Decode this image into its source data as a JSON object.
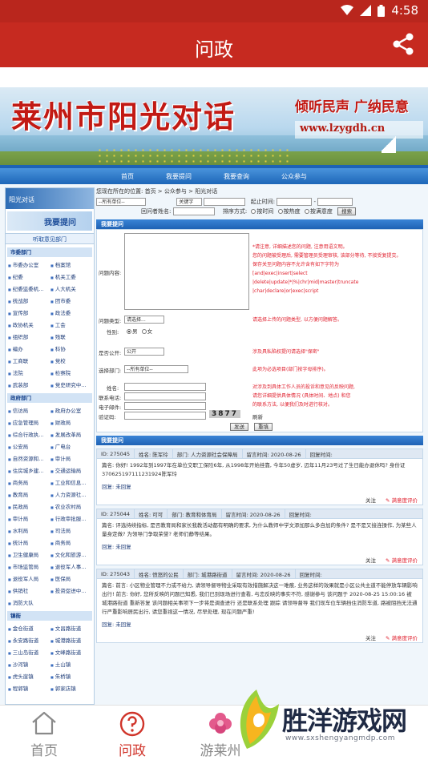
{
  "status": {
    "time": "4:58"
  },
  "appbar": {
    "title": "问政",
    "share_icon": "share-icon"
  },
  "banner": {
    "title": "莱州市阳光对话",
    "slogan": "倾听民声 广纳民意",
    "url": "www.lzygdh.cn"
  },
  "portal_nav": [
    "首页",
    "我要提问",
    "我要查询",
    "公众参与"
  ],
  "left": {
    "img1": "阳光对话",
    "img2": "我要提问",
    "head": "听取意见部门",
    "sec1": "市委部门",
    "depts1": [
      "市委办公室",
      "档案馆",
      "纪委",
      "机关工委",
      "纪委监委机...",
      "人大机关",
      "统战部",
      "团市委",
      "宣传部",
      "政法委",
      "政协机关",
      "工会",
      "组织部",
      "残联",
      "编办",
      "科协",
      "工商联",
      "党校",
      "法院",
      "检察院",
      "武装部",
      "党史研究中..."
    ],
    "sec2": "政府部门",
    "depts2": [
      "信访局",
      "政府办公室",
      "应急管理局",
      "财政局",
      "综合行政执...",
      "发展改革局",
      "公安局",
      "广电台",
      "自然资源和...",
      "审计局",
      "住房城乡建...",
      "交通运输局",
      "商务局",
      "工业和信息...",
      "教育局",
      "人力资源社...",
      "民政局",
      "农业农村局",
      "审计局",
      "行政审批服...",
      "水利局",
      "司法局",
      "统计局",
      "商务局",
      "卫生健康局",
      "文化和旅游...",
      "市场监管局",
      "退役军人事...",
      "退役军人局",
      "医保局",
      "供销社",
      "投资促进中...",
      "消防大队"
    ],
    "sec3": "镇街",
    "depts3": [
      "金仓街道",
      "文昌路街道",
      "永安路街道",
      "城港路街道",
      "三山岛街道",
      "文峰路街道",
      "沙河镇",
      "土山镇",
      "虎头崖镇",
      "朱桥镇",
      "程郭镇",
      "郭家店镇"
    ]
  },
  "main": {
    "crumb": "您现在所在的位置: 首页 > 公众参与 > 阳光对话",
    "filter_dept": "--所有单位--",
    "filter_kw": "关键字",
    "start_label": "起止时间:",
    "title_label": "回问者姓名:",
    "sort_label": "排序方式:",
    "sort_opts": [
      "按时间",
      "按热度",
      "按满意度"
    ],
    "search_btn": "搜索",
    "form_head": "我要提问",
    "q_label": "问题内容:",
    "hint1": [
      "*请注意, 详细描述您的问题, 注意用语文明。",
      "您的问题被受理后, 需要管理员受理审核, 该部分等待, 不接受复提交。",
      "保存关至问题内容不允许含有如下字符为",
      "[and|exec|insert|select",
      "|delete|update|*|%|chr|mid|master|truncate",
      "|char|declare|or|exec|script"
    ],
    "type_label": "问题类型:",
    "type_value": "请选择...",
    "hint2": "请选择上传的问题类型, 以方便问题解答。",
    "sex_label": "性别:",
    "sex_opts": [
      "男",
      "女"
    ],
    "public_label": "是否公开:",
    "public_value": "公开",
    "hint3": "涉及具私陷权提问请选择\"保密\"",
    "dept_label": "选择部门:",
    "dept_value": "--所有单位--",
    "hint4": "此项为必选项目(部门按字母排序)。",
    "name_label": "姓名:",
    "contact_label": "联系电话:",
    "email_label": "电子邮件:",
    "code_label": "验证码:",
    "code_value": "3877",
    "refresh": "刷新",
    "hint5": [
      "对涉及到具体工作人员的投诉和意见的反映问题,",
      "请您详细提供具体情况 (具体时间、地点) 和您",
      "的联系方法, 以便我们及时进行核对。"
    ],
    "submit": "发送",
    "reset": "重填",
    "list_head": "我要提问"
  },
  "messages": [
    {
      "id": "ID: 275045",
      "name": "姓名: 陈军玲",
      "dept": "部门: 人力资源社会保障局",
      "date": "留言时间: 2020-08-26",
      "status": "回复时间:",
      "q": "篇名: 你好! 1992年到1997年在单位交职工保险6年, 从1998年开始挂靠, 今年50虚岁, 迈年11月23号过了生日能办退休吗? 身份证370625197111231924陈军玲",
      "a": "回复: 未回复",
      "attention": "关注",
      "rate": "满意度评价"
    },
    {
      "id": "ID: 275044",
      "name": "姓名: 可可",
      "dept": "部门: 教育和体育局",
      "date": "留言时间: 2020-08-26",
      "status": "回复时间:",
      "q": "篇名: 评选持续指标, 是否教育局和家长我教活动都有明确的要求, 为什么教师中学文添加那么多自加的条件? 是不是又接连操作, 为某些人量身定做? 为领导门争取荣誉? 老师们静等结果。",
      "a": "回复: 未回复",
      "attention": "关注",
      "rate": "满意度评价"
    },
    {
      "id": "ID: 275043",
      "name": "姓名: 愤怒的公民",
      "dept": "部门: 城港路街道",
      "date": "留言时间: 2020-08-26",
      "status": "回复时间:",
      "q": "篇名: 前言: 小区物业管理不力或不给力, 请领导督导物业采取有效措施解决这一难痕, 业务这样的效果就是小区公共主道不能停放车辆影响出行! 前言: 你好, 您所反映的问题已知悉, 我们已到现场进行查看, 与恋反映的事实不符, 感谢参与 该问题于 2020-08-25 15:00:16 被 城港路街道 重新答复 该问题相关事项下一步将是调查进行 还是联系处理 跟踪 请领导督导 我们现车位车辆挡住消防车道, 路被阻挡无法通行严重影响居民出行, 请您重视这一情况, 尽早处理, 现在问题严重!",
      "a": "回复: 未回复",
      "attention": "关注",
      "rate": "满意度评价"
    }
  ],
  "bottomnav": [
    {
      "label": "首页",
      "icon": "home-icon",
      "active": false
    },
    {
      "label": "问政",
      "icon": "question-icon",
      "active": true
    },
    {
      "label": "游莱州",
      "icon": "flower-icon",
      "active": false
    }
  ],
  "watermark": {
    "title": "胜洋游戏网",
    "url": "www.sxshengyangmdp.com"
  }
}
